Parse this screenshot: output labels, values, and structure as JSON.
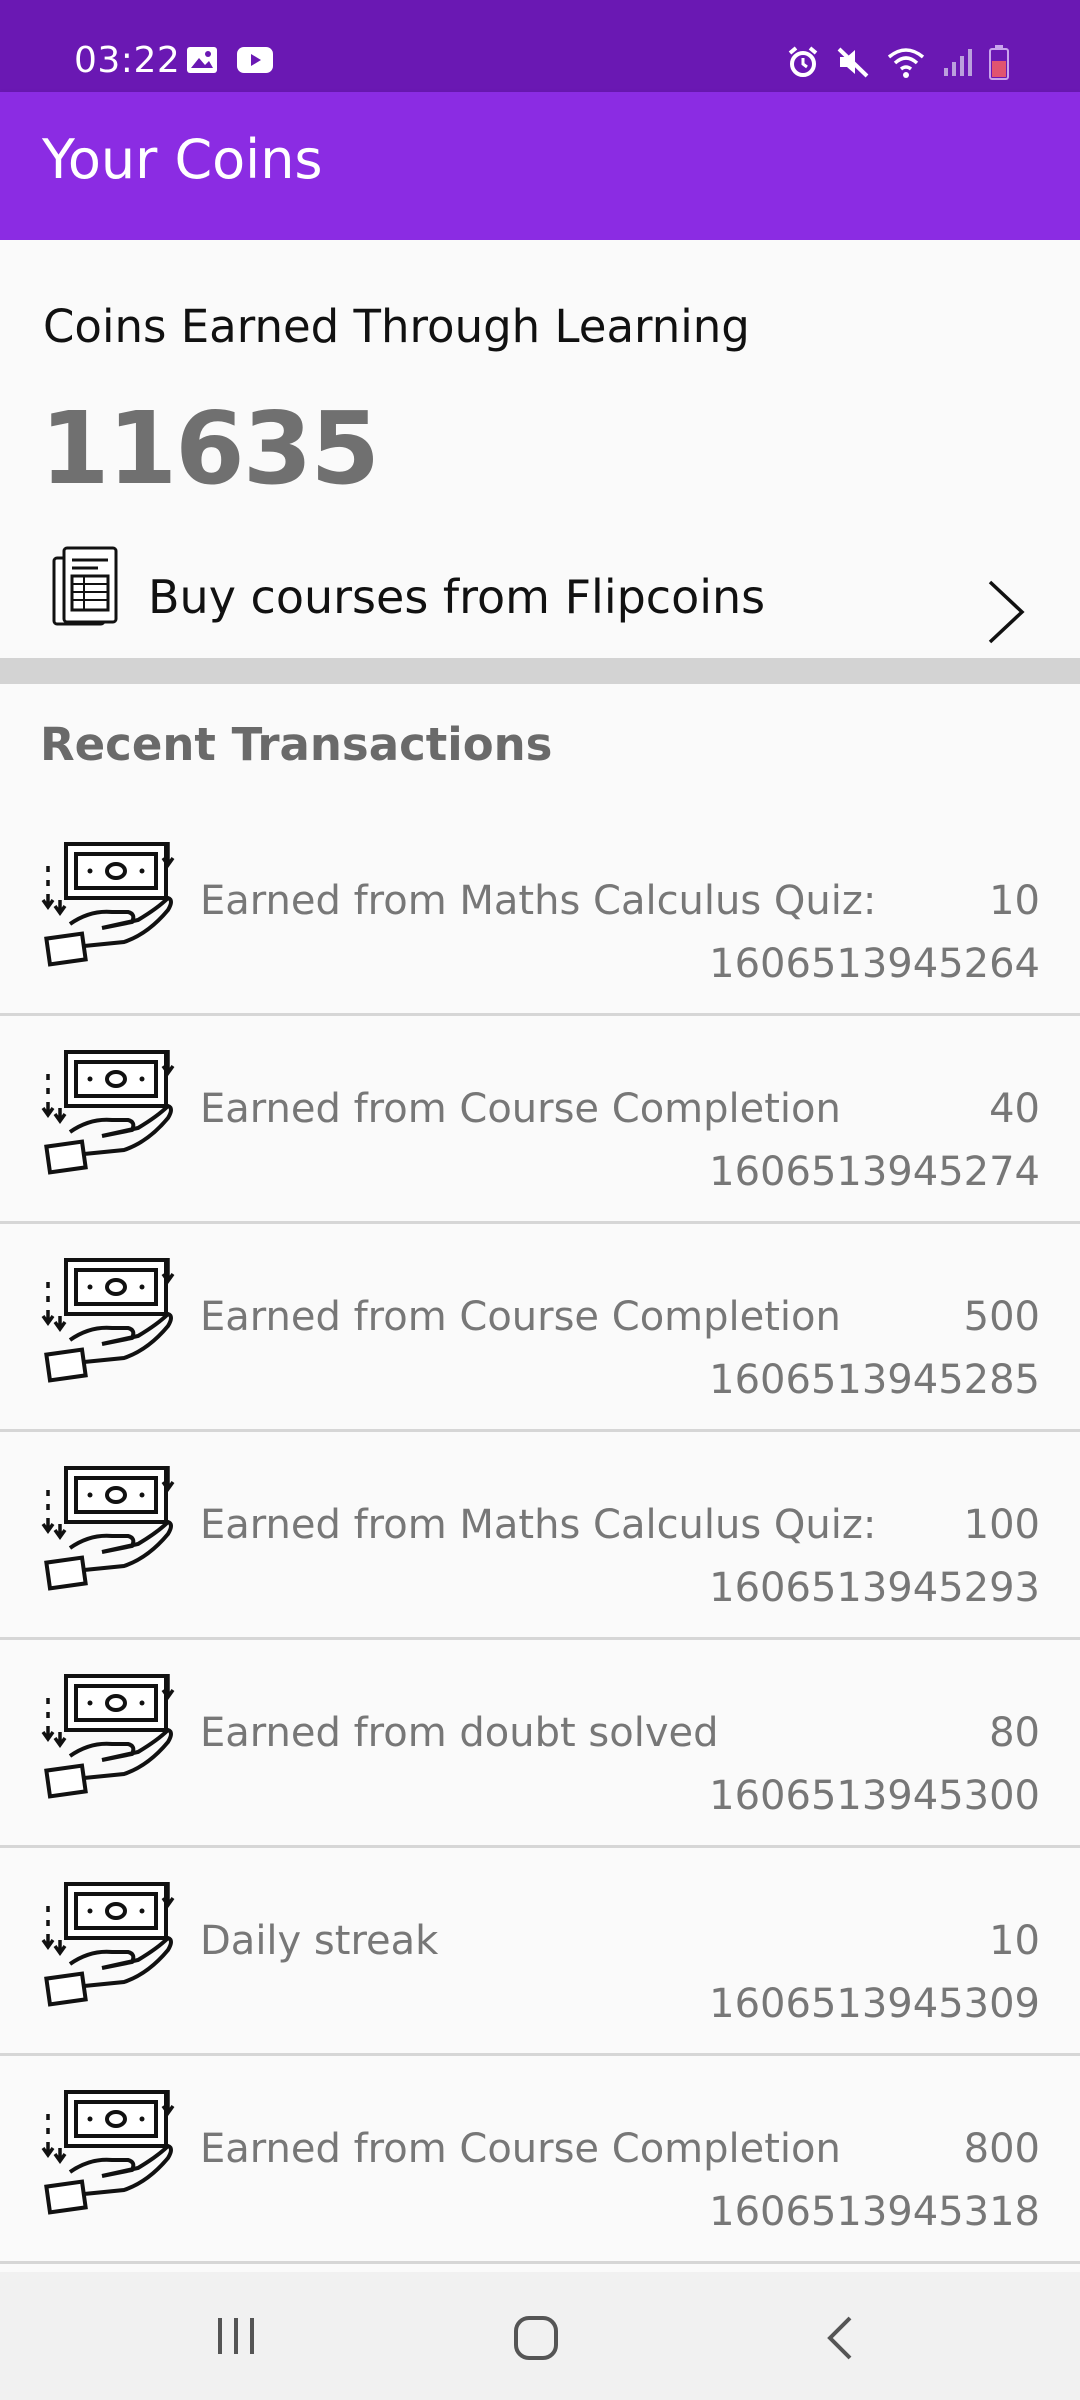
{
  "status_bar": {
    "time": "03:22",
    "left_icons": [
      "image-icon",
      "youtube-icon"
    ],
    "right_icons": [
      "alarm-icon",
      "mute-icon",
      "wifi-icon",
      "signal-icon",
      "battery-icon"
    ]
  },
  "app_bar": {
    "title": "Your Coins"
  },
  "coins": {
    "heading": "Coins Earned Through Learning",
    "total": "11635",
    "buy_label": "Buy courses from Flipcoins"
  },
  "recent": {
    "title": "Recent Transactions"
  },
  "transactions": [
    {
      "description": "Earned from Maths Calculus Quiz:",
      "amount": "10",
      "id": "1606513945264"
    },
    {
      "description": "Earned from Course Completion",
      "amount": "40",
      "id": "1606513945274"
    },
    {
      "description": "Earned from Course Completion",
      "amount": "500",
      "id": "1606513945285"
    },
    {
      "description": "Earned from Maths Calculus Quiz:",
      "amount": "100",
      "id": "1606513945293"
    },
    {
      "description": "Earned from doubt solved",
      "amount": "80",
      "id": "1606513945300"
    },
    {
      "description": "Daily streak",
      "amount": "10",
      "id": "1606513945309"
    },
    {
      "description": "Earned from Course Completion",
      "amount": "800",
      "id": "1606513945318"
    }
  ],
  "nav_bar": {
    "buttons": [
      "recents-icon",
      "home-icon",
      "back-icon"
    ]
  },
  "colors": {
    "status_bar": "#6a18b3",
    "app_bar": "#8b2ce3",
    "total_text": "#707070",
    "divider": "#d3d3d3"
  }
}
